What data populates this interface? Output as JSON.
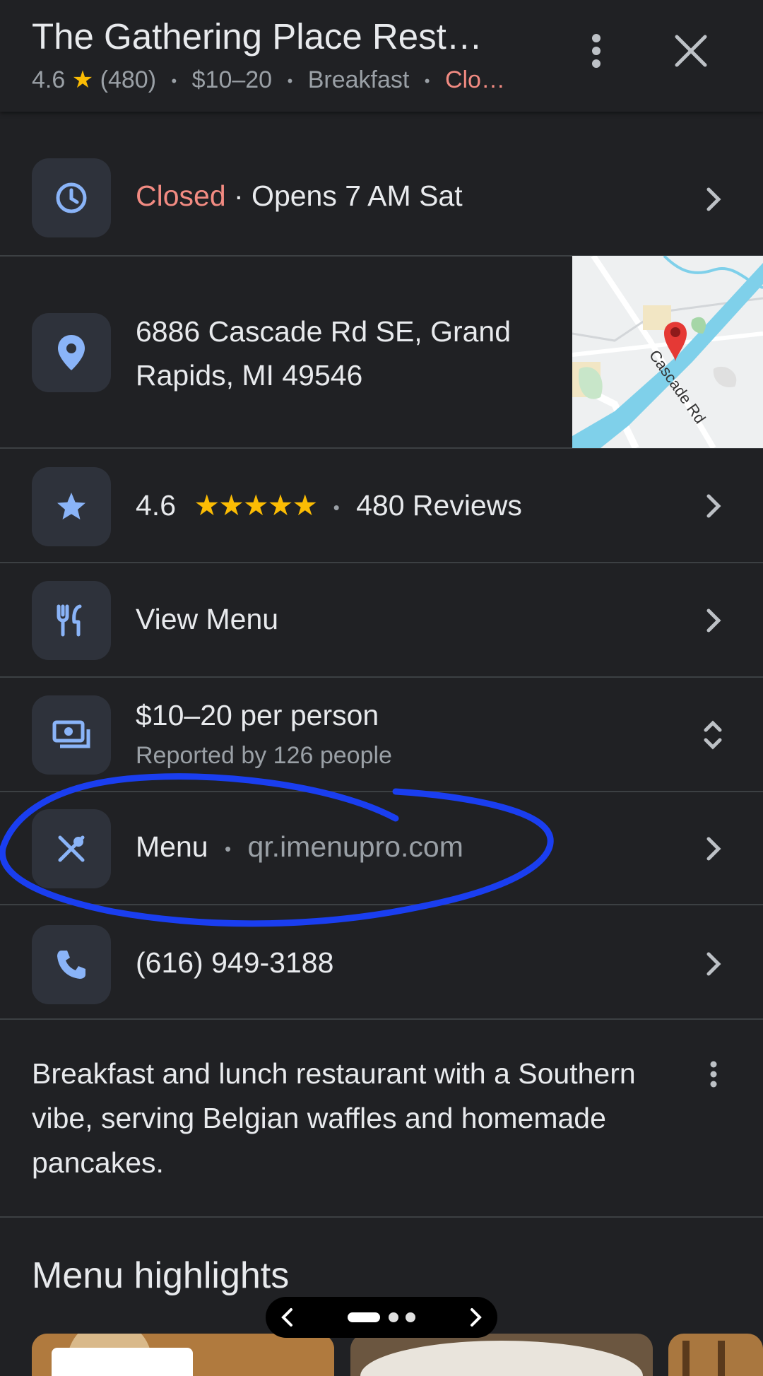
{
  "header": {
    "title": "The Gathering Place Rest…",
    "rating": "4.6",
    "star": "★",
    "review_count": "(480)",
    "price": "$10–20",
    "category": "Breakfast",
    "status": "Clo…"
  },
  "hours": {
    "status": "Closed",
    "opens": " · Opens 7 AM Sat"
  },
  "address": {
    "line1": "6886 Cascade Rd SE, Grand",
    "line2": "Rapids, MI 49546",
    "map_label": "Cascade Rd"
  },
  "rating_row": {
    "rating": "4.6",
    "stars": "★★★★★",
    "reviews": "480 Reviews"
  },
  "view_menu": {
    "label": "View Menu"
  },
  "price_row": {
    "label": "$10–20 per person",
    "sub": "Reported by 126 people"
  },
  "menu_link": {
    "label": "Menu",
    "url": "qr.imenupro.com"
  },
  "phone": {
    "number": "(616) 949-3188"
  },
  "description": "Breakfast and lunch restaurant with a Southern vibe, serving Belgian waffles and homemade pancakes.",
  "menu_highlights": {
    "title": "Menu highlights"
  },
  "colors": {
    "background": "#202124",
    "accent_icon": "#8ab4f8",
    "closed": "#f28b82",
    "star": "#fbbc04",
    "annotation": "#1a3ef0"
  }
}
